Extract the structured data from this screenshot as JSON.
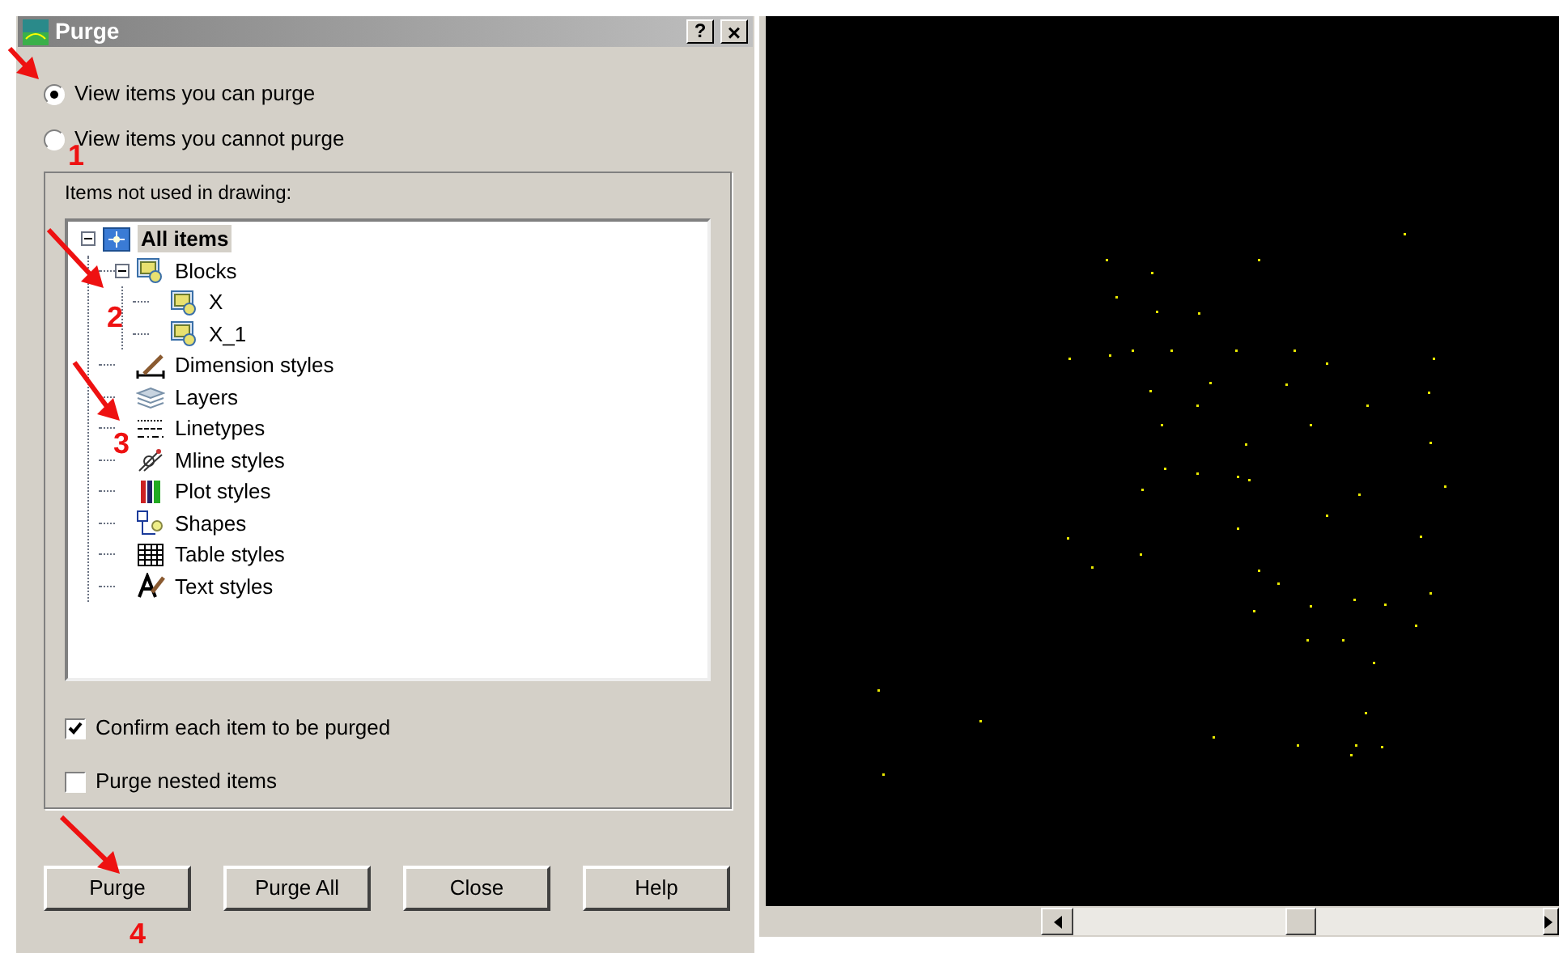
{
  "window": {
    "title": "Purge",
    "help_button": "?",
    "close_button": "×"
  },
  "view_options": [
    {
      "label": "View items you can purge",
      "selected": true
    },
    {
      "label": "View items you cannot purge",
      "selected": false
    }
  ],
  "group": {
    "label": "Items not used in drawing:"
  },
  "tree": [
    {
      "label": "All items",
      "kind": "root",
      "selected": true,
      "expanded": true,
      "children": [
        {
          "label": "Blocks",
          "kind": "block",
          "selected": false,
          "expanded": true,
          "children": [
            {
              "label": "X",
              "kind": "block",
              "selected": false
            },
            {
              "label": "X_1",
              "kind": "block",
              "selected": false
            }
          ]
        },
        {
          "label": "Dimension styles",
          "kind": "dimstyle",
          "selected": false
        },
        {
          "label": "Layers",
          "kind": "layer",
          "selected": false
        },
        {
          "label": "Linetypes",
          "kind": "linetype",
          "selected": false
        },
        {
          "label": "Mline styles",
          "kind": "mline",
          "selected": false
        },
        {
          "label": "Plot styles",
          "kind": "plotstyle",
          "selected": false
        },
        {
          "label": "Shapes",
          "kind": "shape",
          "selected": false
        },
        {
          "label": "Table styles",
          "kind": "table",
          "selected": false
        },
        {
          "label": "Text styles",
          "kind": "textstyle",
          "selected": false
        }
      ]
    }
  ],
  "options": [
    {
      "label": "Confirm each item to be purged",
      "checked": true
    },
    {
      "label": "Purge nested items",
      "checked": false
    }
  ],
  "buttons": [
    "Purge",
    "Purge All",
    "Close",
    "Help"
  ],
  "annotations": [
    "1",
    "2",
    "3",
    "4"
  ]
}
